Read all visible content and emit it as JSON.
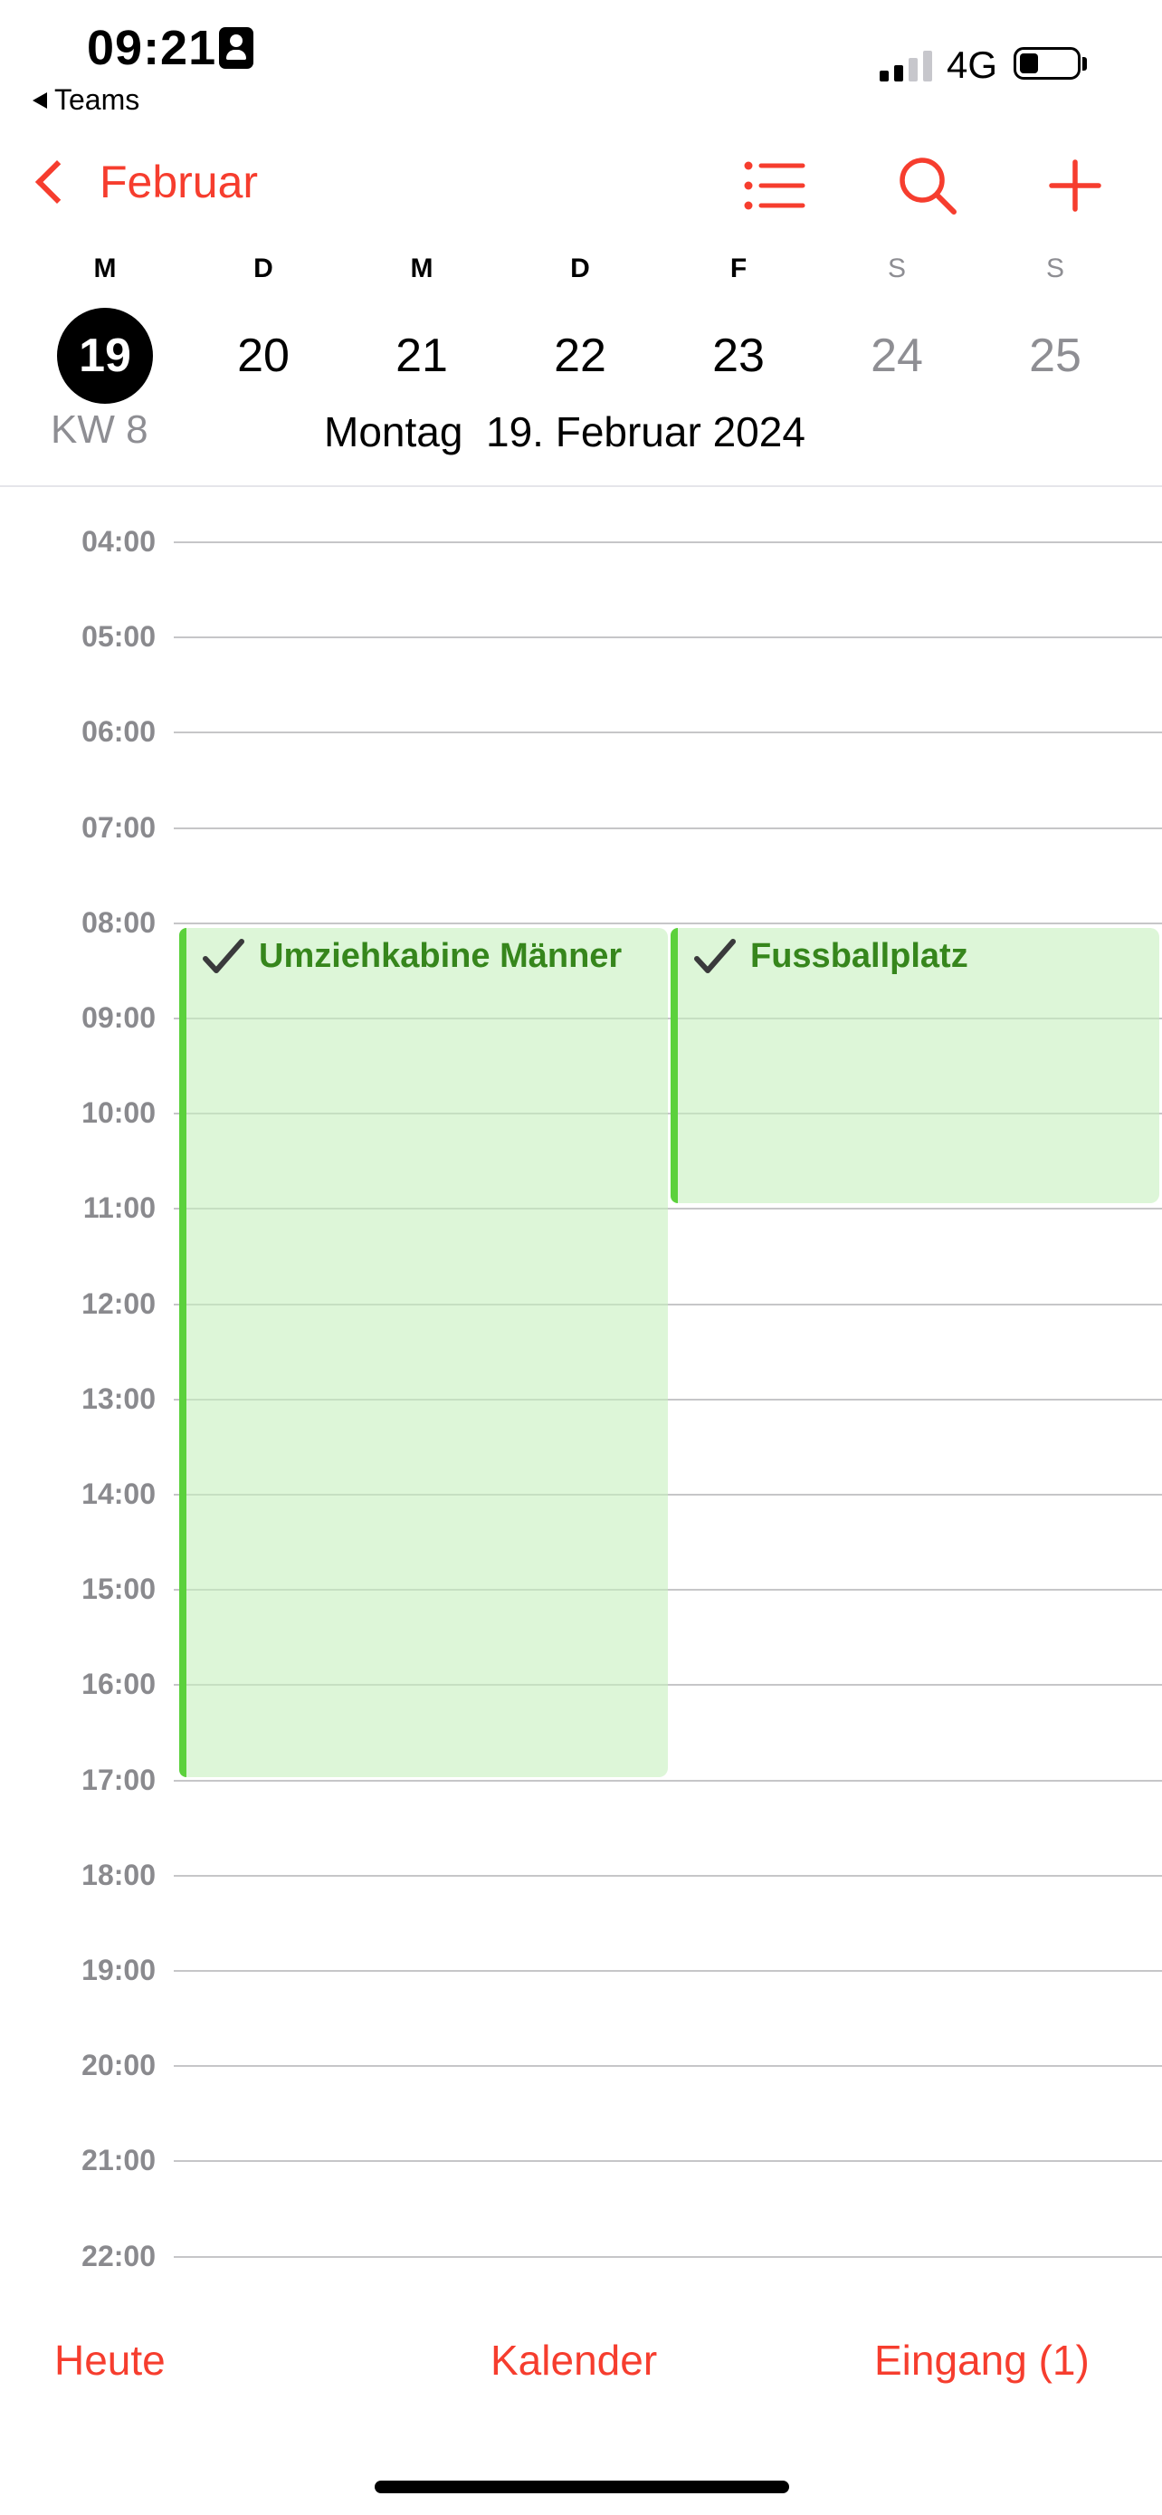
{
  "status_bar": {
    "time": "09:21",
    "back_app": "Teams",
    "network": "4G",
    "icons": [
      "id-card-icon",
      "cellular-signal-icon",
      "battery-icon"
    ]
  },
  "nav": {
    "back_label": "Februar",
    "icons": [
      "chevron-left-icon",
      "list-icon",
      "search-icon",
      "plus-icon"
    ],
    "accent_color": "#f63d2e"
  },
  "week": {
    "weekdays": [
      "M",
      "D",
      "M",
      "D",
      "F",
      "S",
      "S"
    ],
    "days": [
      "19",
      "20",
      "21",
      "22",
      "23",
      "24",
      "25"
    ],
    "selected_day": "19",
    "week_label": "KW 8",
    "selected_weekday_name": "Montag",
    "selected_date": "19. Februar 2024"
  },
  "hours": [
    "04:00",
    "05:00",
    "06:00",
    "07:00",
    "08:00",
    "09:00",
    "10:00",
    "11:00",
    "12:00",
    "13:00",
    "14:00",
    "15:00",
    "16:00",
    "17:00",
    "18:00",
    "19:00",
    "20:00",
    "21:00",
    "22:00"
  ],
  "events": [
    {
      "title": "Umziehkabine Männer",
      "icon": "checkmark-icon",
      "start": "08:00",
      "end": "17:00",
      "color": "#5bd13c"
    },
    {
      "title": "Fussballplatz",
      "icon": "checkmark-icon",
      "start": "08:00",
      "end": "11:00",
      "color": "#5bd13c"
    }
  ],
  "toolbar": {
    "today": "Heute",
    "calendars": "Kalender",
    "inbox": "Eingang (1)"
  }
}
